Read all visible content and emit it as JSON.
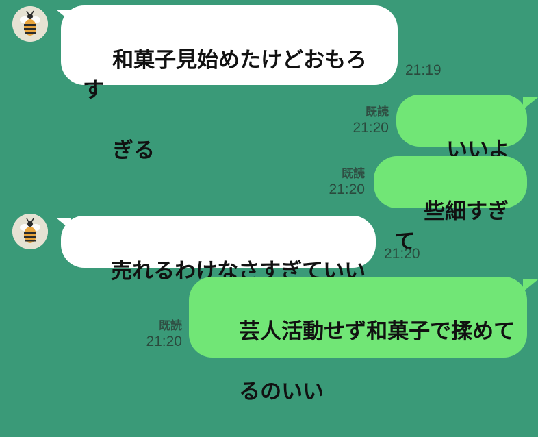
{
  "theme": {
    "background": "#3a9a78",
    "incoming_bubble": "#ffffff",
    "outgoing_bubble": "#71e676"
  },
  "avatar_icon": "bee-icon",
  "messages": [
    {
      "direction": "incoming",
      "text": "和菓子見始めたけどおもろすぎる",
      "line1": "和菓子見始めたけどおもろす",
      "line2": "ぎる",
      "time": "21:19"
    },
    {
      "direction": "outgoing",
      "text": "いいよな",
      "read": "既読",
      "time": "21:20"
    },
    {
      "direction": "outgoing",
      "text": "些細すぎて",
      "read": "既読",
      "time": "21:20"
    },
    {
      "direction": "incoming",
      "text": "売れるわけなさすぎていい",
      "time": "21:20"
    },
    {
      "direction": "outgoing",
      "text": "芸人活動せず和菓子で揉めてるのいい",
      "line1": "芸人活動せず和菓子で揉めて",
      "line2": "るのいい",
      "read": "既読",
      "time": "21:20"
    }
  ]
}
